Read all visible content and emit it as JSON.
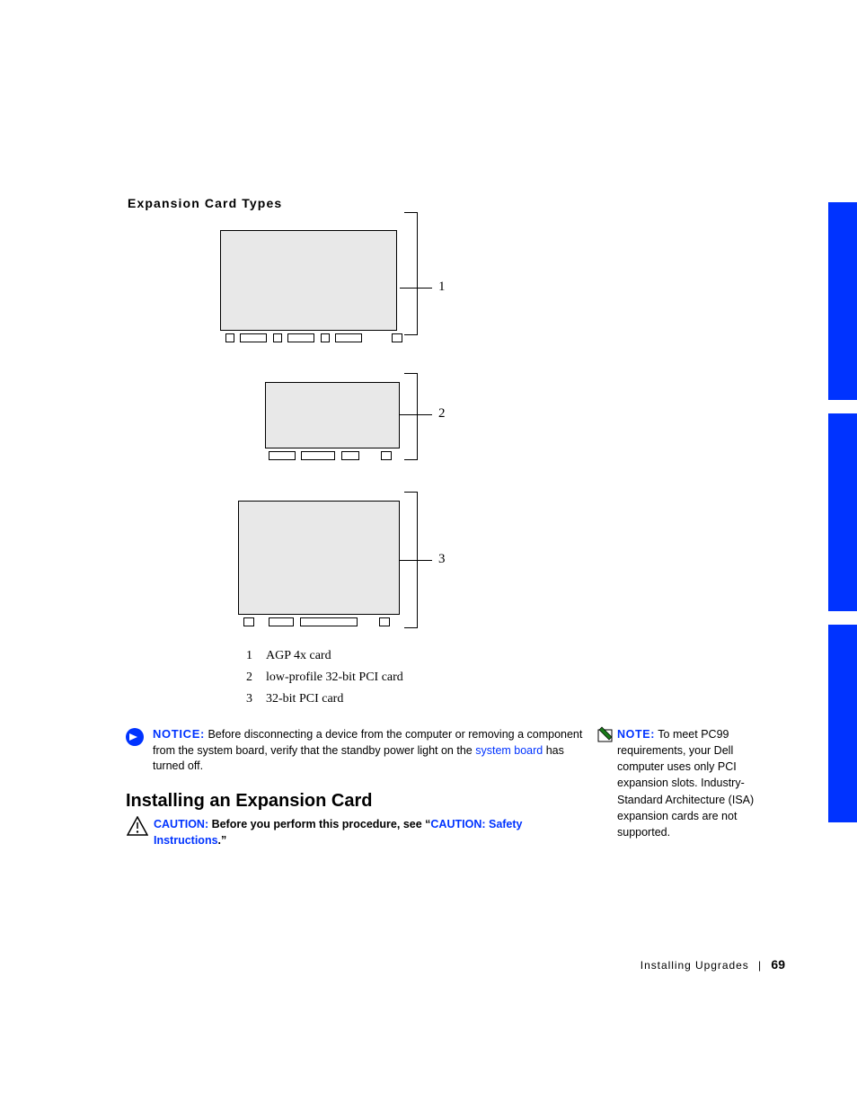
{
  "heading_types": "Expansion Card Types",
  "diagram": {
    "labels": {
      "one": "1",
      "two": "2",
      "three": "3"
    }
  },
  "legend": [
    {
      "num": "1",
      "text": "AGP 4x card"
    },
    {
      "num": "2",
      "text": "low-profile 32-bit PCI card"
    },
    {
      "num": "3",
      "text": "32-bit PCI card"
    }
  ],
  "notice": {
    "label": "NOTICE:",
    "text_before": " Before disconnecting a device from the computer or removing a component from the system board, verify that the standby power light on the ",
    "link": "system board",
    "text_after": " has turned off."
  },
  "section_title": "Installing an Expansion Card",
  "caution": {
    "label": "CAUTION:",
    "mid": " Before you perform this procedure, see “",
    "link": "CAUTION: Safety Instructions",
    "after": ".”"
  },
  "note": {
    "label": "NOTE:",
    "text": " To meet PC99 requirements, your Dell computer uses only PCI expansion slots. Industry-Standard Architecture (ISA) expansion cards are not supported."
  },
  "footer": {
    "section": "Installing Upgrades",
    "page": "69"
  }
}
